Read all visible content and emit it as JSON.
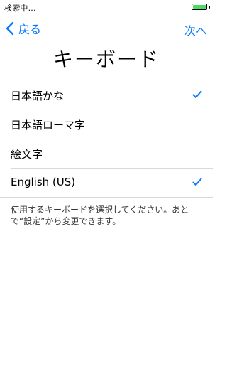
{
  "status_bar": {
    "carrier_text": "検索中...",
    "battery_color": "#4cd964",
    "battery_level": 1.0
  },
  "nav": {
    "back_label": "戻る",
    "next_label": "次へ",
    "accent_color": "#0a7aff"
  },
  "page": {
    "title": "キーボード"
  },
  "keyboards": [
    {
      "label": "日本語かな",
      "checked": true
    },
    {
      "label": "日本語ローマ字",
      "checked": false
    },
    {
      "label": "絵文字",
      "checked": false
    },
    {
      "label": "English (US)",
      "checked": true
    }
  ],
  "footnote": "使用するキーボードを選択してください。あとで“設定”から変更できます。"
}
